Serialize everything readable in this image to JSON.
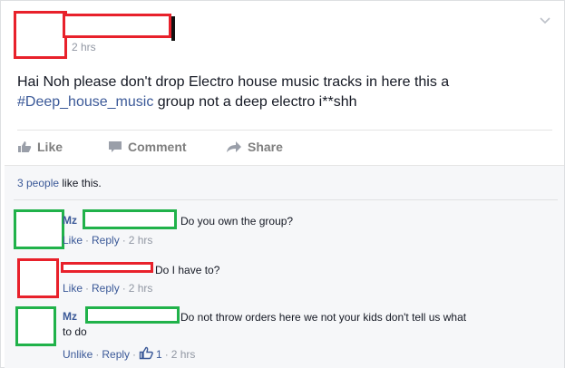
{
  "post": {
    "timestamp": "2 hrs",
    "text_prefix": "Hai Noh please don't drop Electro house music tracks in here this a",
    "hashtag": "#Deep_house_music",
    "text_suffix": " group not a deep electro i**shh"
  },
  "actions": {
    "like_label": "Like",
    "comment_label": "Comment",
    "share_label": "Share"
  },
  "likes": {
    "count_label": "3 people",
    "suffix": " like this."
  },
  "comments": [
    {
      "name": "Mz",
      "text": "Do you own the group?",
      "meta": {
        "like": "Like",
        "reply": "Reply",
        "time": "2 hrs"
      }
    },
    {
      "name": "",
      "text": "Do I have to?",
      "meta": {
        "like": "Like",
        "reply": "Reply",
        "time": "2 hrs"
      }
    },
    {
      "name": "Mz",
      "text_line1": "Do not throw orders here we not your kids don't tell us what",
      "text_line2": "to do",
      "meta": {
        "like": "Unlike",
        "reply": "Reply",
        "like_count": "1",
        "time": "2 hrs"
      }
    }
  ],
  "colors": {
    "redaction_red": "#e8212b",
    "redaction_green": "#20b24a",
    "link_blue": "#3b5998"
  },
  "icons": [
    "chevron-down-icon",
    "thumbs-up-icon",
    "comment-icon",
    "share-arrow-icon"
  ]
}
